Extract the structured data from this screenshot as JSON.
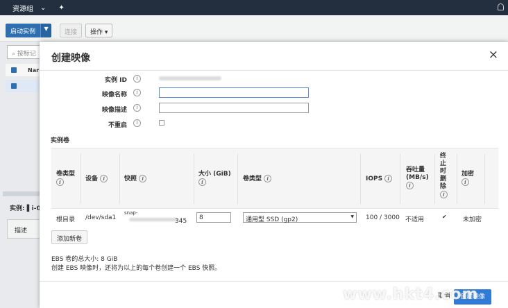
{
  "topnav": {
    "resource_group": "资源组",
    "pin_icon": "pin-icon",
    "bell_icon": "bell-icon"
  },
  "background": {
    "launch_label": "启动实例",
    "connect_label": "连接",
    "actions_label": "操作 ▾",
    "search_placeholder": "按标记",
    "name_col": "Nar",
    "instance_label": "实例: ▌i-0",
    "tab_desc": "描述"
  },
  "modal": {
    "title": "创建映像",
    "close": "×",
    "fields": {
      "instance_id_label": "实例 ID",
      "image_name_label": "映像名称",
      "image_desc_label": "映像描述",
      "no_reboot_label": "不重启"
    },
    "section_title": "实例卷",
    "table": {
      "headers": {
        "volume_type": "卷类型",
        "device": "设备",
        "snapshot": "快照",
        "size": "大小 (GiB)",
        "vol_type": "卷类型",
        "iops": "IOPS",
        "throughput": "吞吐量 (MB/s)",
        "delete_on_term": "终止时删除",
        "encrypted": "加密"
      },
      "row": {
        "volume_type": "根目录",
        "device": "/dev/sda1",
        "snapshot_prefix": "snap-",
        "snapshot_suffix": "345",
        "size": "8",
        "vol_type": "通用型 SSD (gp2)",
        "iops": "100 / 3000",
        "throughput": "不适用",
        "delete_on_term": true,
        "encrypted": "未加密"
      }
    },
    "add_volume_label": "添加新卷",
    "footnote_total": "EBS 卷的总大小: 8 GiB",
    "footnote_snapshot": "创建 EBS 映像时，还将为以上的每个卷创建一个 EBS 快照。",
    "cancel_label": "取消",
    "create_label": "创建映像"
  },
  "watermark": "www.hkt4.com",
  "colors": {
    "nav_bg": "#232f3e",
    "primary": "#2f7bd6"
  }
}
